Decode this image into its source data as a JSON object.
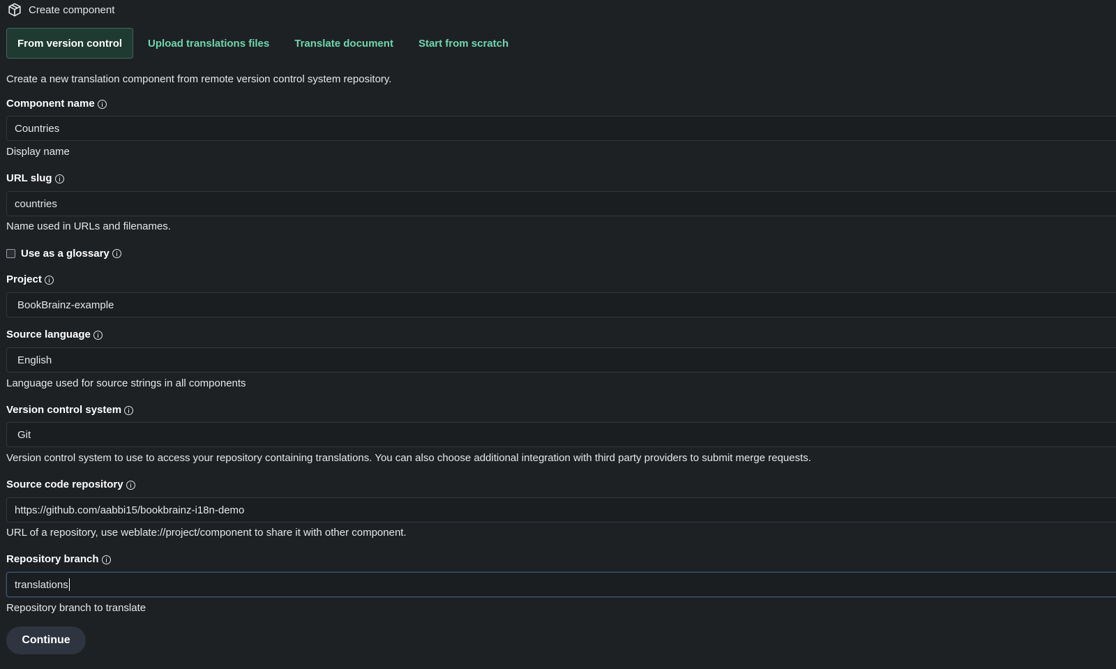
{
  "header": {
    "title": "Create component",
    "icon": "cube-icon"
  },
  "tabs": [
    {
      "label": "From version control",
      "active": true
    },
    {
      "label": "Upload translations files",
      "active": false
    },
    {
      "label": "Translate document",
      "active": false
    },
    {
      "label": "Start from scratch",
      "active": false
    }
  ],
  "intro": "Create a new translation component from remote version control system repository.",
  "form": {
    "component_name": {
      "label": "Component name",
      "value": "Countries",
      "help": "Display name"
    },
    "url_slug": {
      "label": "URL slug",
      "value": "countries",
      "help": "Name used in URLs and filenames."
    },
    "glossary": {
      "label": "Use as a glossary",
      "checked": false
    },
    "project": {
      "label": "Project",
      "value": "BookBrainz-example"
    },
    "source_language": {
      "label": "Source language",
      "value": "English",
      "help": "Language used for source strings in all components"
    },
    "vcs": {
      "label": "Version control system",
      "value": "Git",
      "help": "Version control system to use to access your repository containing translations. You can also choose additional integration with third party providers to submit merge requests."
    },
    "repo": {
      "label": "Source code repository",
      "value": "https://github.com/aabbi15/bookbrainz-i18n-demo",
      "help": "URL of a repository, use weblate://project/component to share it with other component."
    },
    "branch": {
      "label": "Repository branch",
      "value": "translations",
      "help": "Repository branch to translate"
    }
  },
  "continue_label": "Continue",
  "colors": {
    "background": "#1e2124",
    "tab_link": "#6fd6ad",
    "tab_active_bg": "#1f3a30",
    "button_bg": "#2e3440",
    "focus_border": "#3b5876"
  }
}
